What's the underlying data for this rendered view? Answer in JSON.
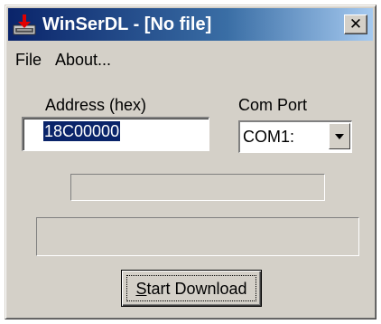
{
  "window": {
    "title": "WinSerDL - [No file]",
    "close_glyph": "✕"
  },
  "menu": [
    {
      "label": "File"
    },
    {
      "label": "About..."
    }
  ],
  "form": {
    "address_label": "Address (hex)",
    "address_value": "18C00000",
    "com_port_label": "Com Port",
    "com_port_value": "COM1:"
  },
  "progress": {
    "value": 0
  },
  "status": {
    "text": ""
  },
  "start_button": {
    "mnemonic": "S",
    "label_rest": "tart Download"
  },
  "colors": {
    "title_active": "#0a246a",
    "face": "#d4d0c8",
    "selection": "#0a246a"
  },
  "icons": {
    "app": "download-arrow-icon",
    "combo": "chevron-down-icon"
  }
}
